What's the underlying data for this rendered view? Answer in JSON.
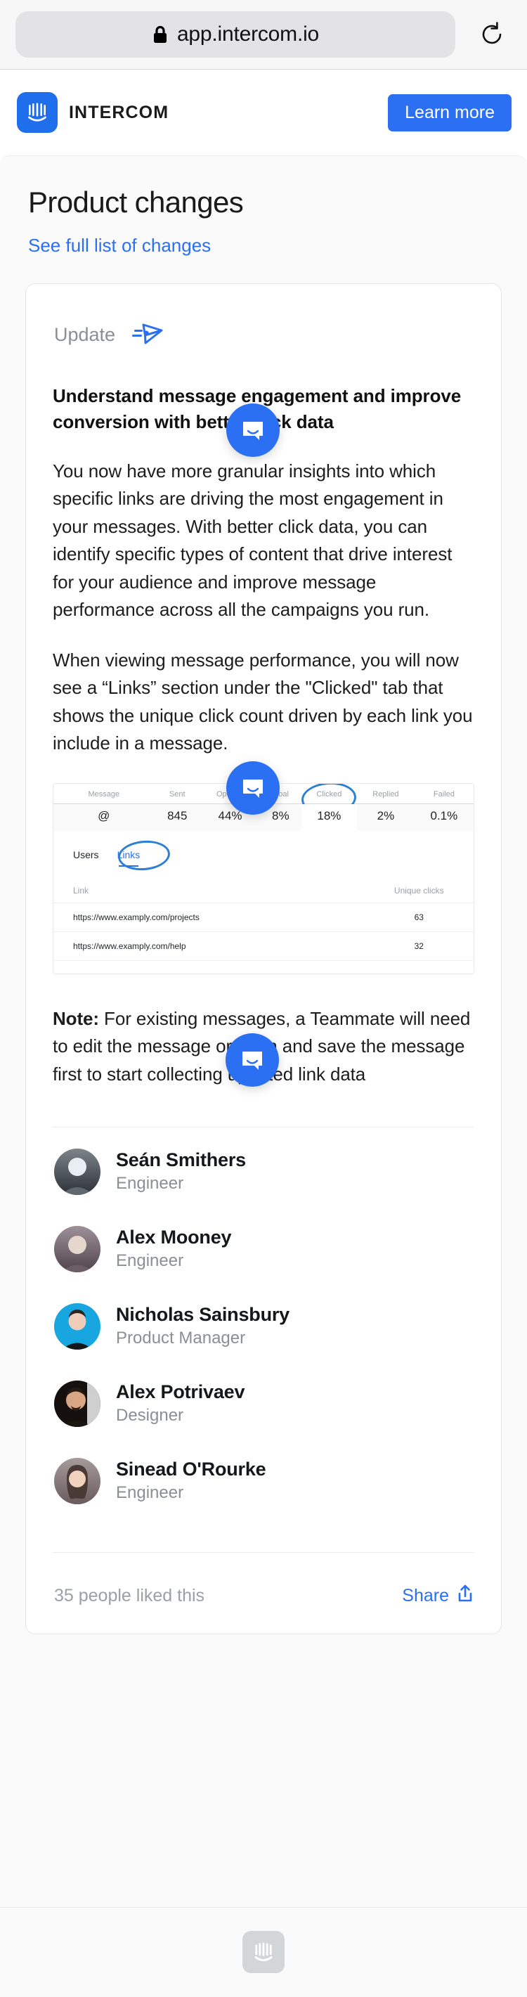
{
  "browser": {
    "url": "app.intercom.io",
    "lock_icon": "lock-icon",
    "reload_icon": "reload-icon"
  },
  "header": {
    "brand_name": "INTERCOM",
    "logo_icon": "intercom-logo-icon",
    "cta_label": "Learn more",
    "accent_color": "#2b6ff2"
  },
  "page": {
    "title": "Product changes",
    "full_list_link": "See full list of changes"
  },
  "article": {
    "kicker": "Update",
    "kicker_icon": "paper-plane-icon",
    "headline": "Understand message engagement and improve conversion with better click data",
    "paragraphs": [
      "You now have more granular insights into which specific links are driving the most engagement in your messages. With better click data, you can identify specific types of content that drive interest for your audience and improve message performance across all the campaigns you run.",
      "When viewing message performance, you will now see a “Links” section under the \"Clicked\" tab that shows the unique click count driven by each link you include in a message."
    ],
    "note_label": "Note:",
    "note_text": " For existing messages, a Teammate will need to edit the message or open and save the message first to start collecting updated link data"
  },
  "embed": {
    "metrics": {
      "columns": [
        "Message",
        "Sent",
        "Opened",
        "Goal",
        "Clicked",
        "Replied",
        "Failed"
      ],
      "row": [
        "@",
        "845",
        "44%",
        "8%",
        "18%",
        "2%",
        "0.1%"
      ],
      "highlighted_column": "Clicked"
    },
    "tabs": [
      {
        "label": "Users",
        "active": false
      },
      {
        "label": "Links",
        "active": true
      }
    ],
    "links_table": {
      "columns": [
        "Link",
        "Unique clicks"
      ],
      "rows": [
        {
          "link": "https://www.examply.com/projects",
          "clicks": "63"
        },
        {
          "link": "https://www.examply.com/help",
          "clicks": "32"
        }
      ]
    }
  },
  "people": [
    {
      "name": "Seán Smithers",
      "role": "Engineer",
      "avatar_color": "#6b7177",
      "avatar_color2": "#2b3136"
    },
    {
      "name": "Alex Mooney",
      "role": "Engineer",
      "avatar_color": "#8d7c86",
      "avatar_color2": "#5a4c55"
    },
    {
      "name": "Nicholas Sainsbury",
      "role": "Product Manager",
      "avatar_color": "#18a6e0",
      "avatar_color2": "#0d7fb3"
    },
    {
      "name": "Alex Potrivaev",
      "role": "Designer",
      "avatar_color": "#3a2f2a",
      "avatar_color2": "#120d0b"
    },
    {
      "name": "Sinead O'Rourke",
      "role": "Engineer",
      "avatar_color": "#9b8f90",
      "avatar_color2": "#6a5c5e"
    }
  ],
  "footer": {
    "liked_count": "35 people liked this",
    "share_label": "Share",
    "share_icon": "share-icon"
  },
  "messenger": {
    "launcher_icon": "messenger-chat-icon",
    "bottom_logo_icon": "intercom-logo-icon"
  }
}
